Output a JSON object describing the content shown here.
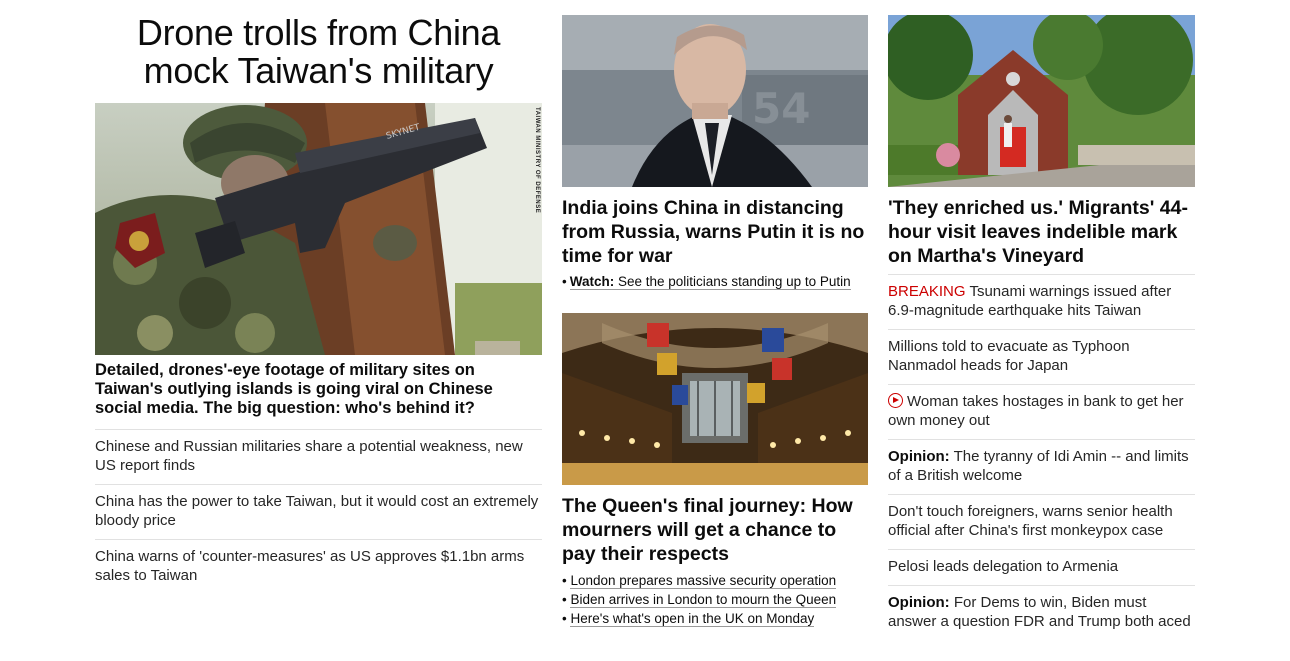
{
  "left": {
    "headline": "Drone trolls from China mock Taiwan's military",
    "image_credit": "TAIWAN MINISTRY OF DEFENSE",
    "image_gun_text": "SKYNET",
    "lead": "Detailed, drones'-eye footage of military sites on Taiwan's outlying islands is going viral on Chinese social media. The big question: who's behind it?",
    "related": [
      "Chinese and Russian militaries share a potential weakness, new US report finds",
      "China has the power to take Taiwan, but it would cost an extremely bloody price",
      "China warns of 'counter-measures' as US approves $1.1bn arms sales to Taiwan"
    ]
  },
  "middle": {
    "image1_ship_number": "54",
    "headline1": "India joins China in distancing from Russia, warns Putin it is no time for war",
    "watch_label": "Watch:",
    "watch_text": "See the politicians standing up to Putin",
    "headline2": "The Queen's final journey: How mourners will get a chance to pay their respects",
    "links": [
      "London prepares massive security operation",
      "Biden arrives in London to mourn the Queen",
      "Here's what's open in the UK on Monday"
    ]
  },
  "right": {
    "headline": "'They enriched us.' Migrants' 44-hour visit leaves indelible mark on Martha's Vineyard",
    "items": [
      {
        "prefix": "BREAKING",
        "text": "Tsunami warnings issued after 6.9-magnitude earthquake hits Taiwan"
      },
      {
        "prefix": "",
        "text": "Millions told to evacuate as Typhoon Nanmadol heads for Japan"
      },
      {
        "prefix": "",
        "text": "Woman takes hostages in bank to get her own money out"
      },
      {
        "prefix": "Opinion:",
        "text": "The tyranny of Idi Amin -- and limits of a British welcome"
      },
      {
        "prefix": "",
        "text": "Don't touch foreigners, warns senior health official after China's first monkeypox case"
      },
      {
        "prefix": "",
        "text": "Pelosi leads delegation to Armenia"
      },
      {
        "prefix": "Opinion:",
        "text": "For Dems to win, Biden must answer a question FDR and Trump both aced"
      }
    ]
  },
  "colors": {
    "breaking": "#cc0000",
    "text": "#0c0c0c",
    "divider": "#e1e1e1"
  }
}
